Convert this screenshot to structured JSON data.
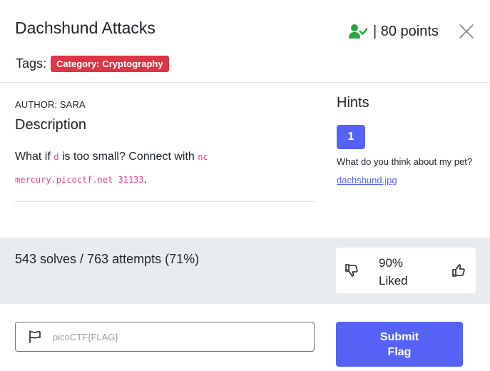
{
  "challenge": {
    "title": "Dachshund Attacks",
    "points_text": "| 80 points",
    "icons": {
      "solved_user": "user-check-icon",
      "close": "close-icon"
    },
    "accent_color": "#5662f6",
    "solved_color": "#28a745"
  },
  "tags": {
    "label": "Tags:",
    "items": [
      {
        "text": "Category: Cryptography",
        "color": "#dc3545"
      }
    ]
  },
  "description": {
    "author": "AUTHOR: SARA",
    "heading": "Description",
    "text_before": "What if",
    "code_var": "d",
    "text_middle": "is too small? Connect with",
    "code_nc": "nc",
    "code_host": "mercury.picoctf.net 31133",
    "text_end": "."
  },
  "hints": {
    "heading": "Hints",
    "items": [
      {
        "number": "1"
      }
    ],
    "hint_text": "What do you think about my pet?",
    "hint_link": "dachshund.jpg"
  },
  "stats": {
    "solves_text": "543 solves / 763 attempts (71%)",
    "liked_percent": "90%",
    "liked_label": "Liked"
  },
  "flag": {
    "placeholder": "picoCTF{FLAG}",
    "value": "",
    "submit_line1": "Submit",
    "submit_line2": "Flag"
  }
}
